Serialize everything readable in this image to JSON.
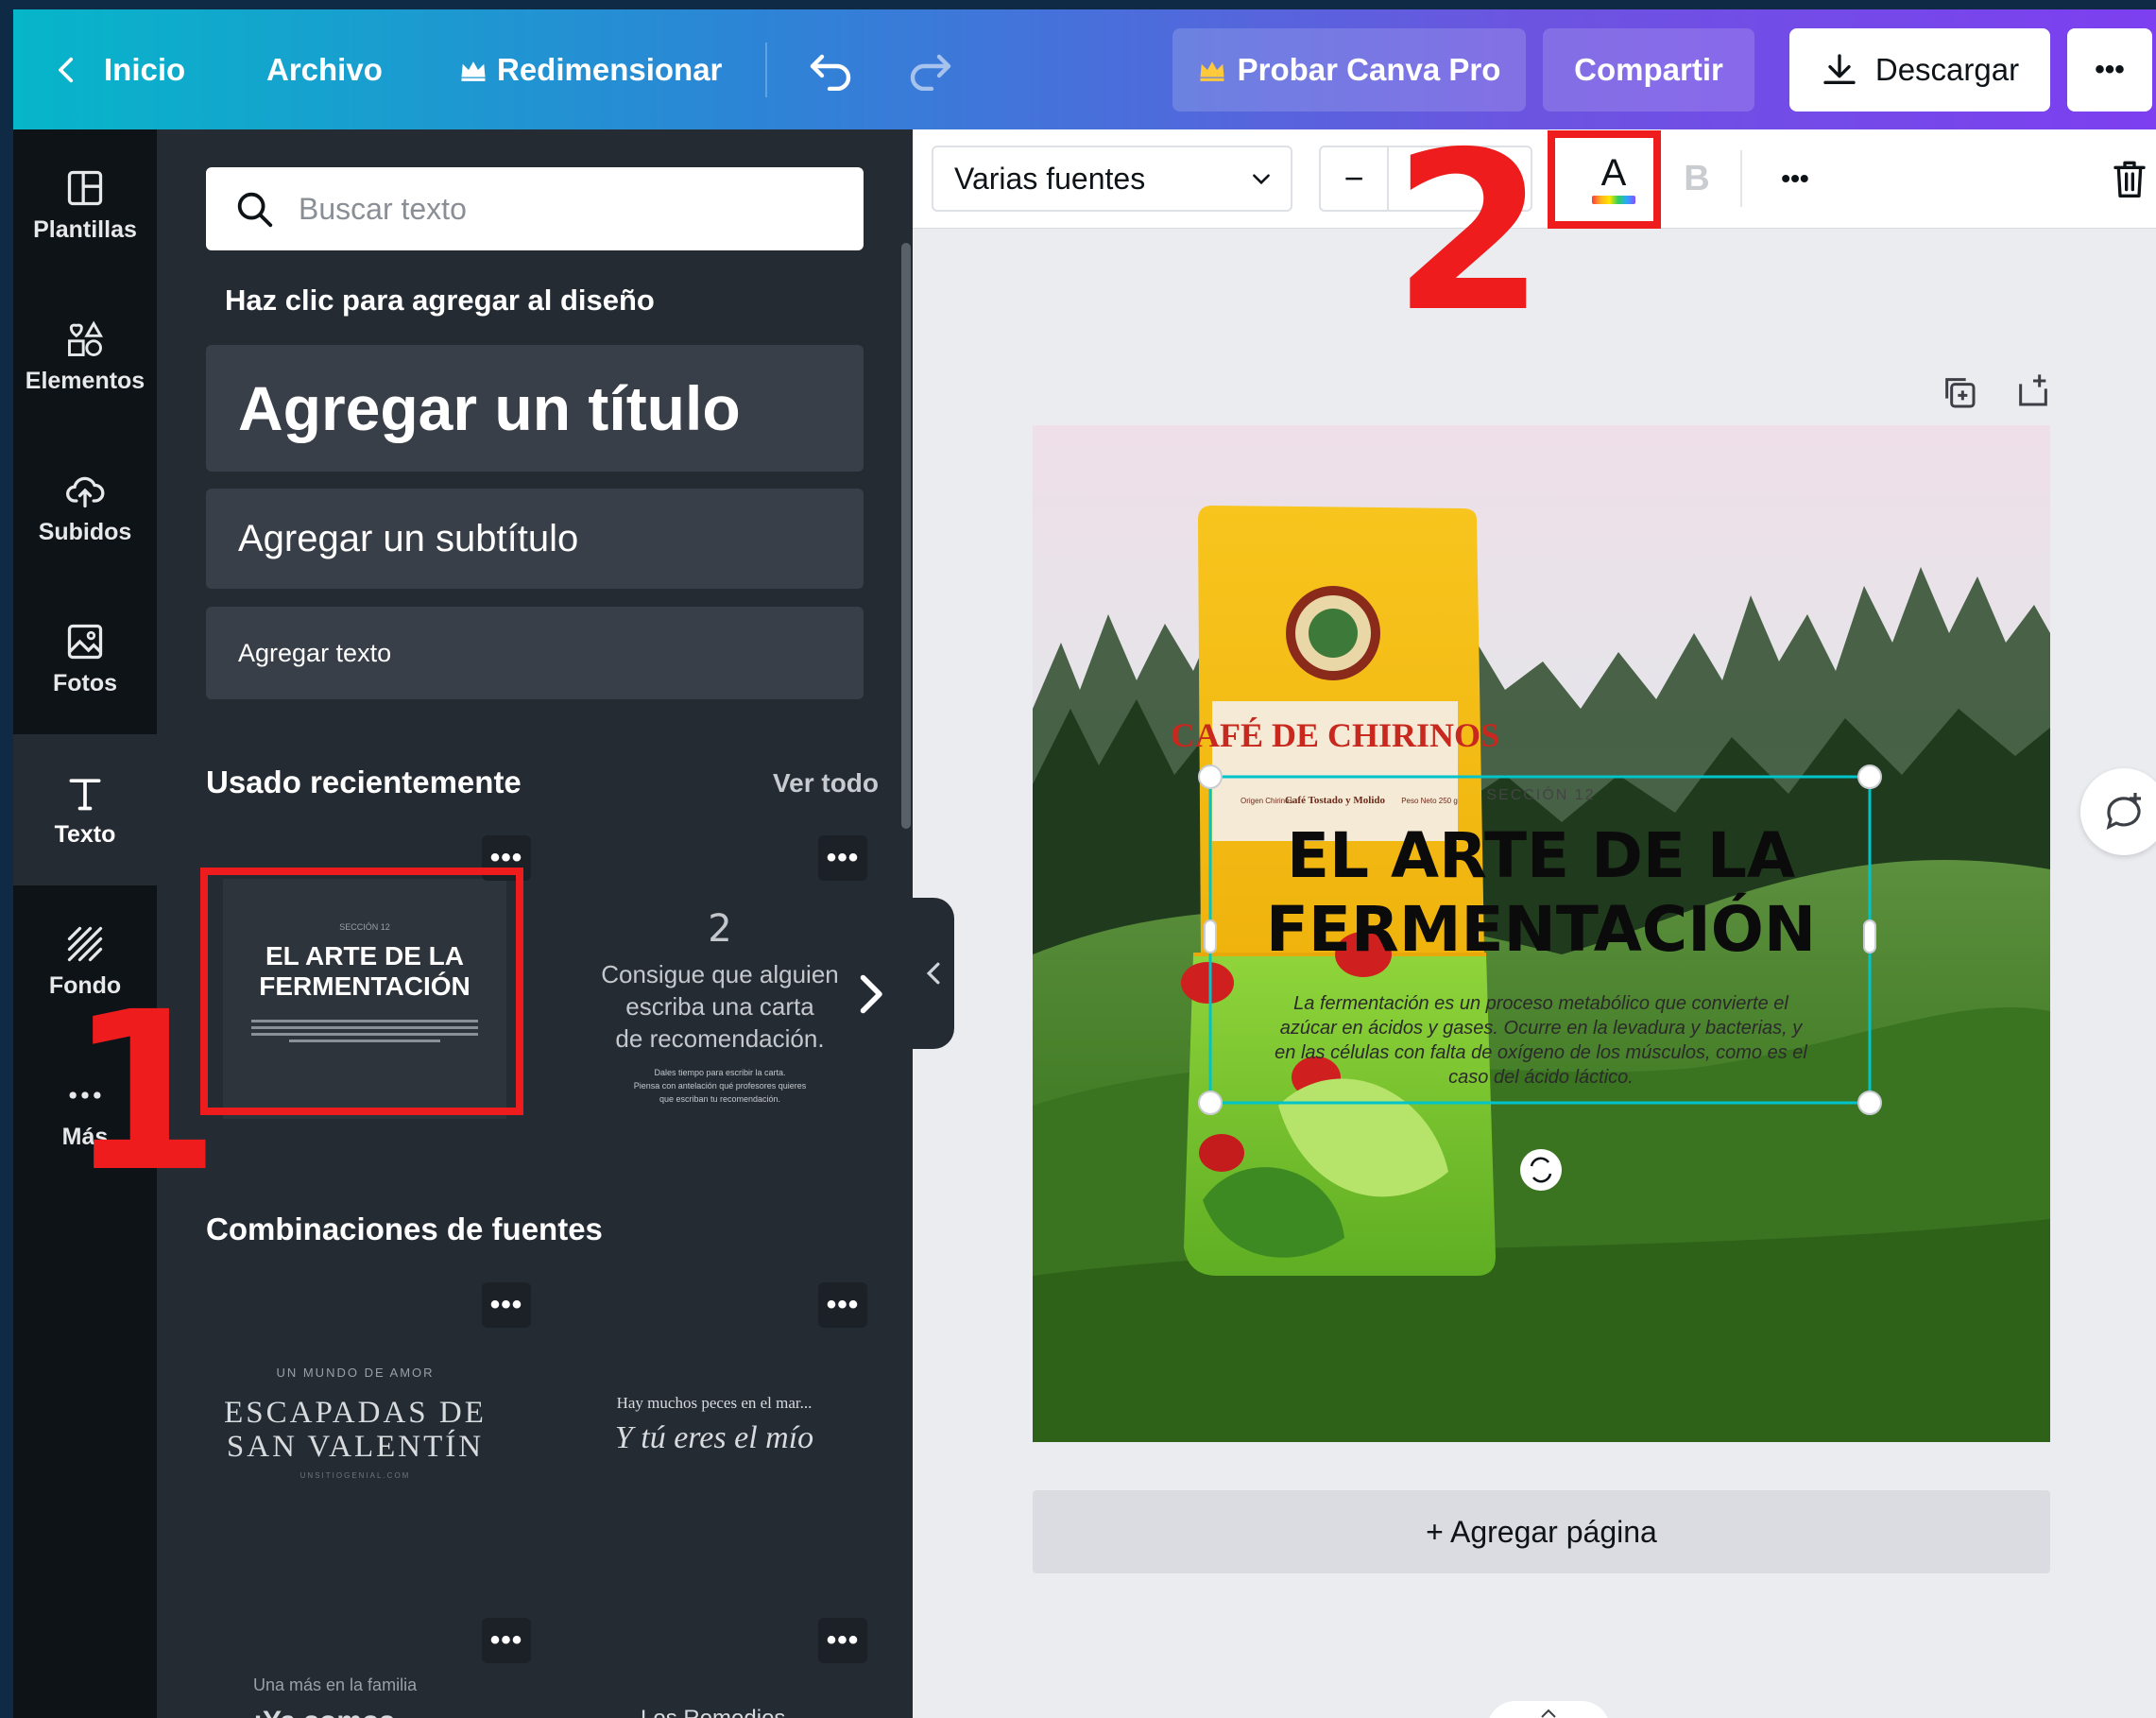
{
  "topbar": {
    "back_label": "Inicio",
    "file_label": "Archivo",
    "resize_label": "Redimensionar",
    "pro_label": "Probar Canva Pro",
    "share_label": "Compartir",
    "download_label": "Descargar",
    "more_label": "•••"
  },
  "rail": {
    "items": [
      {
        "label": "Plantillas",
        "icon": "template-icon"
      },
      {
        "label": "Elementos",
        "icon": "elements-icon"
      },
      {
        "label": "Subidos",
        "icon": "upload-cloud-icon"
      },
      {
        "label": "Fotos",
        "icon": "image-icon"
      },
      {
        "label": "Texto",
        "icon": "text-icon"
      },
      {
        "label": "Fondo",
        "icon": "background-pattern-icon"
      },
      {
        "label": "Más",
        "icon": "more-dots-icon"
      }
    ]
  },
  "panel": {
    "search_placeholder": "Buscar texto",
    "click_hint": "Haz clic para agregar al diseño",
    "add_title": "Agregar un título",
    "add_subtitle": "Agregar un subtítulo",
    "add_text": "Agregar texto",
    "recent_heading": "Usado recientemente",
    "see_all": "Ver todo",
    "combos_heading": "Combinaciones de fuentes",
    "recent": [
      {
        "kicker": "SECCIÓN 12",
        "title_line1": "EL ARTE DE LA",
        "title_line2": "FERMENTACIÓN"
      },
      {
        "number": "2",
        "line1": "Consigue que alguien",
        "line2": "escriba una carta",
        "line3": "de recomendación.",
        "small1": "Dales tiempo para escribir la carta.",
        "small2": "Piensa con antelación qué profesores quieres",
        "small3": "que escriban tu recomendación."
      }
    ],
    "combos": [
      {
        "kicker": "UN MUNDO DE AMOR",
        "line1": "ESCAPADAS DE",
        "line2": "SAN VALENTÍN",
        "footer": "UNSITIOGENIAL.COM"
      },
      {
        "line1": "Hay muchos peces en el mar...",
        "line2": "Y tú eres el mío"
      },
      {
        "line1": "Una más en la familia",
        "line2": "¡Ya somos..."
      },
      {
        "line1": "Los Remedios"
      }
    ]
  },
  "toolbar": {
    "font_name": "Varias fuentes",
    "minus": "−",
    "plus": "+",
    "text_color_letter": "A",
    "bold_letter": "B",
    "more": "•••"
  },
  "canvas": {
    "bag_brand": "CAFÉ DE CHIRINOS",
    "bag_sub1": "Origen Chirinos",
    "bag_sub2": "Café Tostado y Molido",
    "bag_sub3": "Peso Neto 250 g",
    "section": "SECCIÓN 12",
    "headline_line1": "EL ARTE DE LA",
    "headline_line2": "FERMENTACIÓN",
    "body_line1": "La fermentación es un proceso metabólico que convierte el",
    "body_line2": "azúcar en ácidos y gases. Ocurre en la levadura y bacterias, y",
    "body_line3": "en las células con falta de oxígeno de los músculos, como es el",
    "body_line4": "caso del ácido láctico."
  },
  "add_page": "+ Agregar página",
  "annotations": {
    "one": "1",
    "two": "2",
    "color": "#ee1c1c"
  },
  "colors": {
    "accent_teal": "#00c4cc",
    "panel_bg": "#252b33",
    "rail_bg": "#0e1318"
  }
}
